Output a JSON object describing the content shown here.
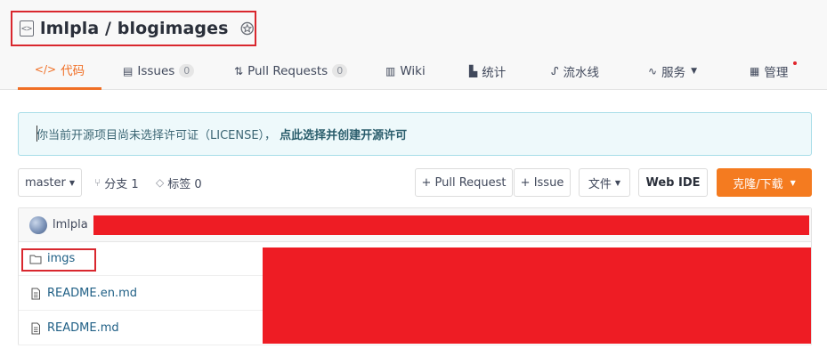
{
  "repo": {
    "title": "lmlpla / blogimages"
  },
  "tabs": [
    {
      "label": "代码",
      "icon": "code-icon",
      "active": true
    },
    {
      "label": "Issues",
      "count": "0",
      "icon": "issues-icon"
    },
    {
      "label": "Pull Requests",
      "count": "0",
      "icon": "pull-request-icon"
    },
    {
      "label": "Wiki",
      "icon": "book-icon"
    },
    {
      "label": "统计",
      "icon": "chart-icon"
    },
    {
      "label": "流水线",
      "icon": "pipeline-icon"
    },
    {
      "label": "服务",
      "icon": "pulse-icon"
    },
    {
      "label": "管理",
      "icon": "doc-icon"
    }
  ],
  "license": {
    "text": "你当前开源项目尚未选择许可证（LICENSE），",
    "link": "点此选择并创建开源许可"
  },
  "toolbar": {
    "branch": "master",
    "branches": "分支 1",
    "tags": "标签 0",
    "pull_request": "+ Pull Request",
    "issue": "+ Issue",
    "files": "文件",
    "web_ide": "Web IDE",
    "clone": "克隆/下载"
  },
  "commit": {
    "author": "lmlpla"
  },
  "files": [
    {
      "name": "imgs",
      "type": "folder"
    },
    {
      "name": "README.en.md",
      "type": "file"
    },
    {
      "name": "README.md",
      "type": "file"
    }
  ],
  "colors": {
    "accent": "#f06f25",
    "redaction": "#ee1c24",
    "highlight_border": "#d9272e"
  }
}
